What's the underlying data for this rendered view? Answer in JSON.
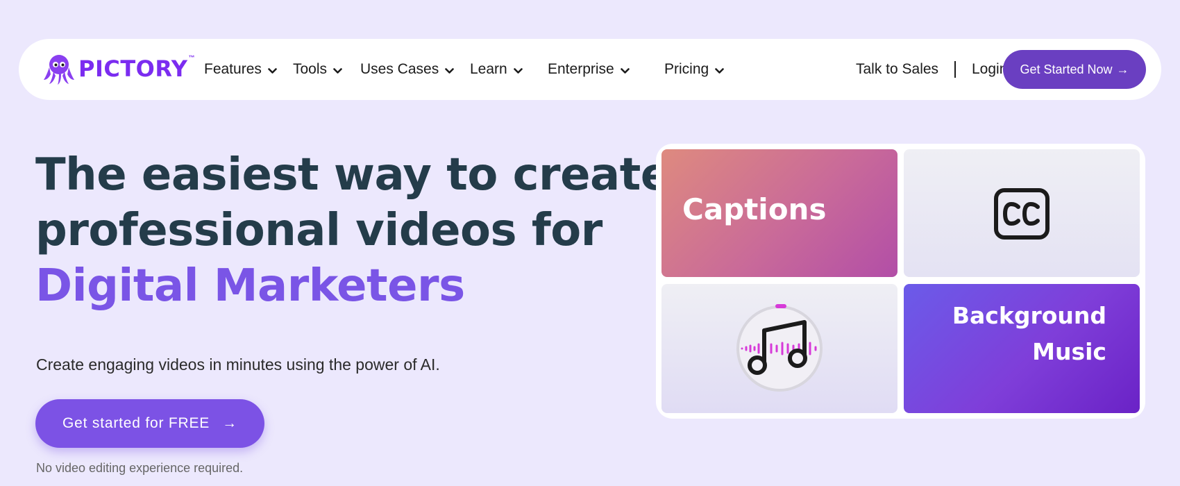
{
  "brand": {
    "name": "PICTORY",
    "tm": "™",
    "color": "#7b2cf0",
    "logo_icon": "octopus-icon"
  },
  "nav": {
    "items": [
      {
        "label": "Features"
      },
      {
        "label": "Tools"
      },
      {
        "label": "Uses Cases"
      },
      {
        "label": "Learn"
      },
      {
        "label": "Enterprise"
      },
      {
        "label": "Pricing"
      }
    ],
    "talk_to_sales": "Talk to Sales",
    "login": "Login",
    "cta": "Get Started Now",
    "cta_arrow": "→"
  },
  "hero": {
    "line1": "The easiest way to create",
    "line2": "professional videos for",
    "line3": "Digital Marketers",
    "subtitle": "Create engaging videos in minutes using the power of AI.",
    "cta": "Get started for FREE",
    "cta_arrow": "→",
    "note": "No video editing experience required."
  },
  "features": {
    "captions": "Captions",
    "cc_icon": "cc-icon",
    "music_icon": "music-note-icon",
    "bg_music_line1": "Background",
    "bg_music_line2": "Music"
  },
  "colors": {
    "page_bg": "#ece8fd",
    "primary": "#6a3fc1",
    "accent_text": "#7a55e6",
    "heading": "#243c4a"
  }
}
